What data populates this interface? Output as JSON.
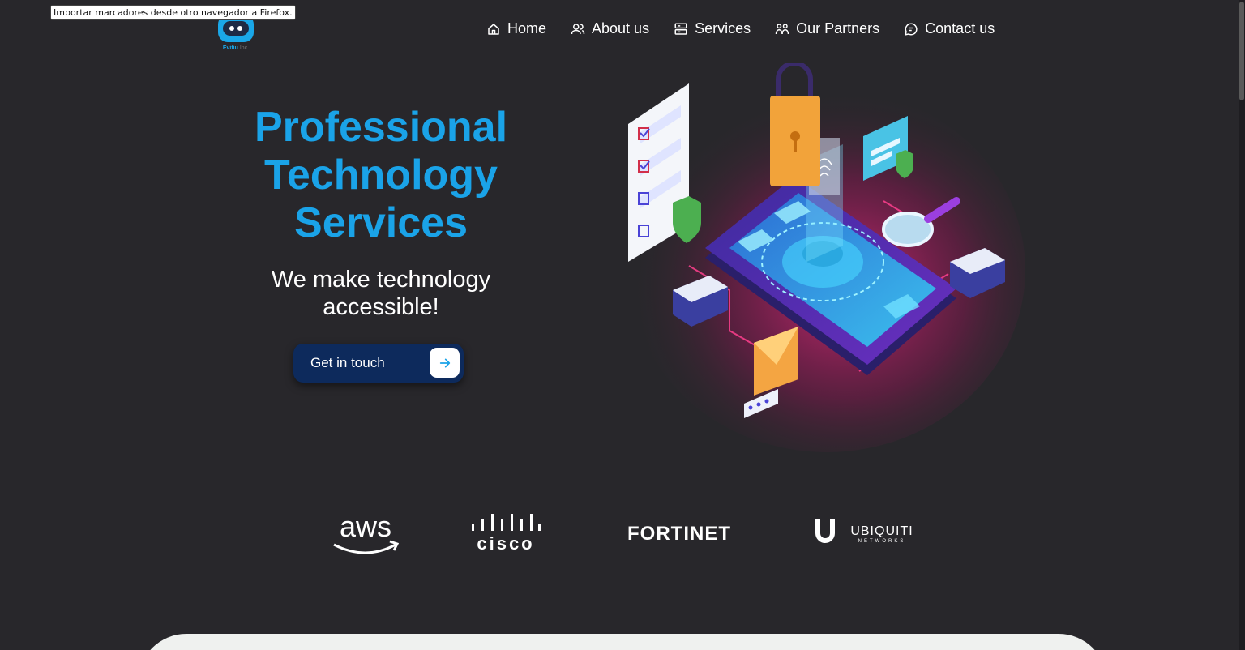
{
  "tooltip": "Importar marcadores desde otro navegador a Firefox.",
  "logo": {
    "brand": "Evitiu",
    "suffix": "Inc."
  },
  "nav": [
    {
      "label": "Home",
      "icon": "home-icon"
    },
    {
      "label": "About us",
      "icon": "users-icon"
    },
    {
      "label": "Services",
      "icon": "server-icon"
    },
    {
      "label": "Our Partners",
      "icon": "partners-icon"
    },
    {
      "label": "Contact us",
      "icon": "chat-icon"
    }
  ],
  "hero": {
    "title_line1": "Professional",
    "title_line2": "Technology",
    "title_line3": "Services",
    "subtitle_line1": "We make technology",
    "subtitle_line2": "accessible!",
    "cta_label": "Get in touch"
  },
  "partners": [
    {
      "name": "aws"
    },
    {
      "name": "cisco"
    },
    {
      "name": "FORTINET"
    },
    {
      "name": "UBIQUITI",
      "tagline": "NETWORKS"
    }
  ],
  "colors": {
    "background": "#28272b",
    "accent": "#1aa3e8",
    "cta_background": "#0d2a5c"
  }
}
